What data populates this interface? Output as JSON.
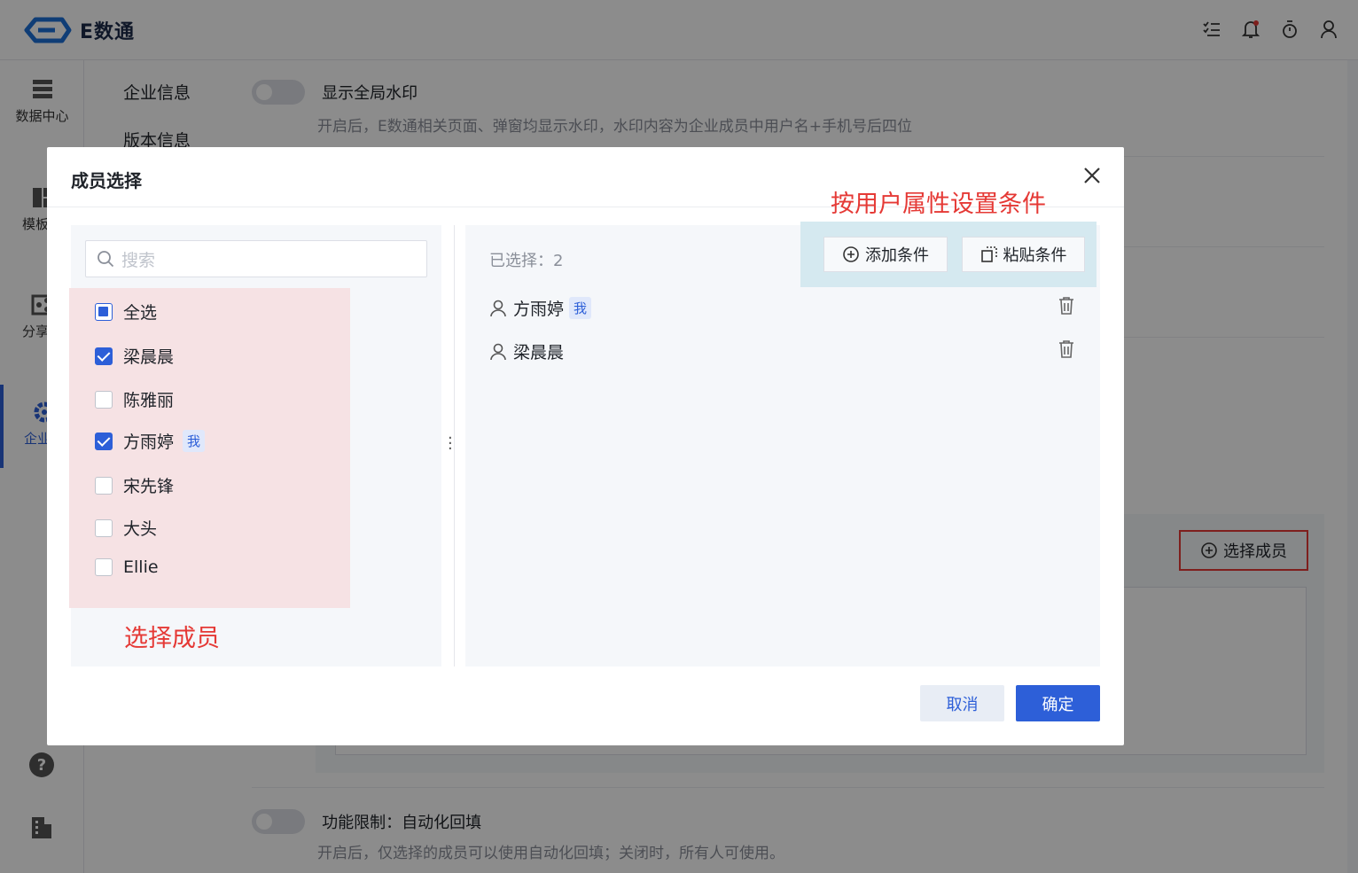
{
  "app": {
    "name": "E数通"
  },
  "topbar": {
    "icons": [
      "tasks-icon",
      "bell-icon",
      "timer-icon",
      "user-icon"
    ]
  },
  "leftnav": {
    "items": [
      {
        "label": "数据中心",
        "icon": "database-icon"
      },
      {
        "label": "模板中",
        "icon": "template-icon"
      },
      {
        "label": "分享组",
        "icon": "share-icon"
      },
      {
        "label": "企业设",
        "icon": "gear-icon",
        "active": true
      }
    ],
    "bottom_icons": [
      "help-icon",
      "building-icon"
    ]
  },
  "subnav": {
    "items": [
      "企业信息",
      "版本信息"
    ]
  },
  "settings": {
    "watermark": {
      "title": "显示全局水印",
      "desc": "开启后，E数通相关页面、弹窗均显示水印，水印内容为企业成员中用户名+手机号后四位"
    },
    "autofill": {
      "title": "功能限制：自动化回填",
      "desc": "开启后，仅选择的成员可以使用自动化回填；关闭时，所有人可使用。"
    },
    "select_member_btn": "选择成员"
  },
  "modal": {
    "title": "成员选择",
    "search_placeholder": "搜索",
    "select_all": "全选",
    "members": [
      {
        "name": "梁晨晨",
        "checked": true,
        "me": false
      },
      {
        "name": "陈雅丽",
        "checked": false,
        "me": false
      },
      {
        "name": "方雨婷",
        "checked": true,
        "me": true
      },
      {
        "name": "宋先锋",
        "checked": false,
        "me": false
      },
      {
        "name": "大头",
        "checked": false,
        "me": false
      },
      {
        "name": "Ellie",
        "checked": false,
        "me": false
      }
    ],
    "me_tag": "我",
    "selected_label": "已选择：2",
    "add_condition": "添加条件",
    "paste_condition": "粘贴条件",
    "selected": [
      {
        "name": "方雨婷",
        "me": true
      },
      {
        "name": "梁晨晨",
        "me": false
      }
    ],
    "cancel": "取消",
    "confirm": "确定"
  },
  "annotations": {
    "left": "选择成员",
    "right": "按用户属性设置条件"
  },
  "colors": {
    "accent": "#2d5fd8",
    "annotation": "#e53935",
    "pink_highlight": "#f6e2e4",
    "blue_highlight": "#d5e9f0"
  }
}
